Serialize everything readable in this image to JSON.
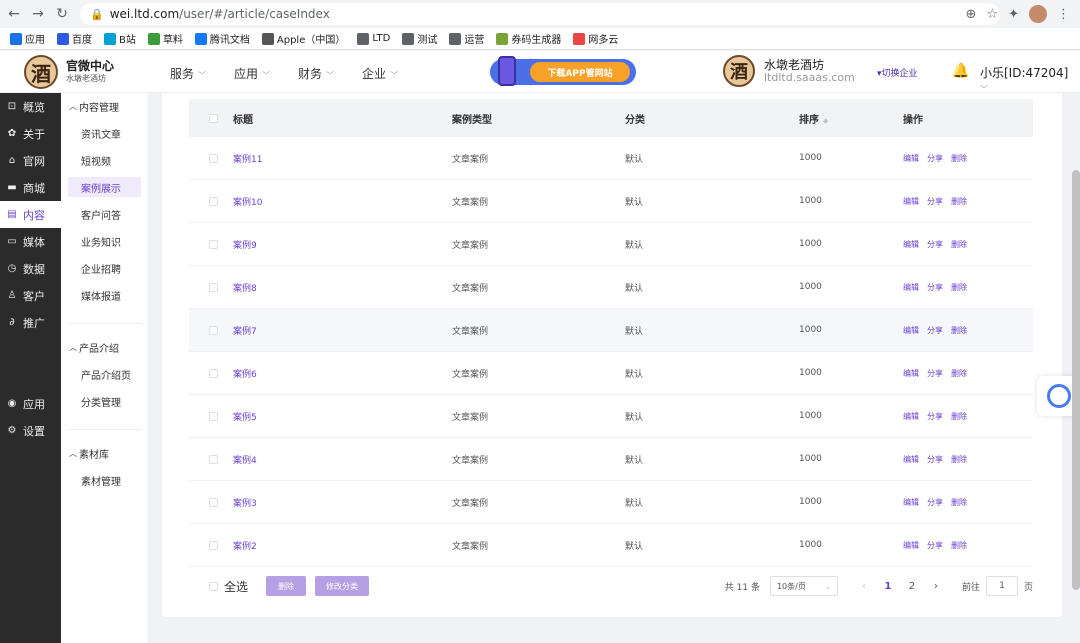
{
  "browser": {
    "url_host": "wei.ltd.com",
    "url_path": "/user/#/article/caseIndex",
    "bookmarks": [
      "应用",
      "百度",
      "B站",
      "草料",
      "腾讯文档",
      "Apple（中国）",
      "LTD",
      "测试",
      "运营",
      "券码生成器",
      "网多云"
    ]
  },
  "header": {
    "brand_title": "官微中心",
    "brand_sub": "水墩老酒坊",
    "logo_char": "酒",
    "nav": [
      "服务",
      "应用",
      "财务",
      "企业"
    ],
    "banner_text": "下载APP管网站",
    "corp_name": "水墩老酒坊",
    "corp_domain": "ltdltd.saaas.com",
    "switch_label": "切换企业",
    "user_label": "小乐[ID:47204]"
  },
  "sidebar": {
    "items": [
      {
        "label": "概览",
        "icon": "overview-icon"
      },
      {
        "label": "关于",
        "icon": "gear-icon"
      },
      {
        "label": "官网",
        "icon": "home-icon"
      },
      {
        "label": "商城",
        "icon": "shop-icon"
      },
      {
        "label": "内容",
        "icon": "document-icon",
        "active": true
      },
      {
        "label": "媒体",
        "icon": "video-icon"
      },
      {
        "label": "数据",
        "icon": "chart-icon"
      },
      {
        "label": "客户",
        "icon": "user-icon"
      },
      {
        "label": "推广",
        "icon": "link-icon"
      }
    ],
    "bottom": [
      {
        "label": "应用",
        "icon": "apps-icon"
      },
      {
        "label": "设置",
        "icon": "settings-icon"
      }
    ]
  },
  "subsidebar": {
    "groups": [
      {
        "title": "内容管理",
        "items": [
          "资讯文章",
          "短视频",
          "案例展示",
          "客户问答",
          "业务知识",
          "企业招聘",
          "媒体报道"
        ]
      },
      {
        "title": "产品介绍",
        "items": [
          "产品介绍页",
          "分类管理"
        ]
      },
      {
        "title": "素材库",
        "items": [
          "素材管理"
        ]
      }
    ],
    "active": "案例展示"
  },
  "table": {
    "headers": {
      "title": "标题",
      "type": "案例类型",
      "category": "分类",
      "sort": "排序",
      "ops": "操作"
    },
    "rows": [
      {
        "title": "案例11",
        "type": "文章案例",
        "category": "默认",
        "sort": "1000"
      },
      {
        "title": "案例10",
        "type": "文章案例",
        "category": "默认",
        "sort": "1000"
      },
      {
        "title": "案例9",
        "type": "文章案例",
        "category": "默认",
        "sort": "1000"
      },
      {
        "title": "案例8",
        "type": "文章案例",
        "category": "默认",
        "sort": "1000"
      },
      {
        "title": "案例7",
        "type": "文章案例",
        "category": "默认",
        "sort": "1000"
      },
      {
        "title": "案例6",
        "type": "文章案例",
        "category": "默认",
        "sort": "1000"
      },
      {
        "title": "案例5",
        "type": "文章案例",
        "category": "默认",
        "sort": "1000"
      },
      {
        "title": "案例4",
        "type": "文章案例",
        "category": "默认",
        "sort": "1000"
      },
      {
        "title": "案例3",
        "type": "文章案例",
        "category": "默认",
        "sort": "1000"
      },
      {
        "title": "案例2",
        "type": "文章案例",
        "category": "默认",
        "sort": "1000"
      }
    ],
    "ops": [
      "编辑",
      "分享",
      "删除"
    ]
  },
  "footer": {
    "select_all": "全选",
    "delete_btn": "删除",
    "modify_btn": "修改分类",
    "total": "共 11 条",
    "page_size": "10条/页",
    "pages": [
      "1",
      "2"
    ],
    "goto_label": "前往",
    "goto_value": "1",
    "page_suffix": "页"
  },
  "colors": {
    "accent": "#6a3fd0",
    "sidebar": "#2b2b2b"
  }
}
